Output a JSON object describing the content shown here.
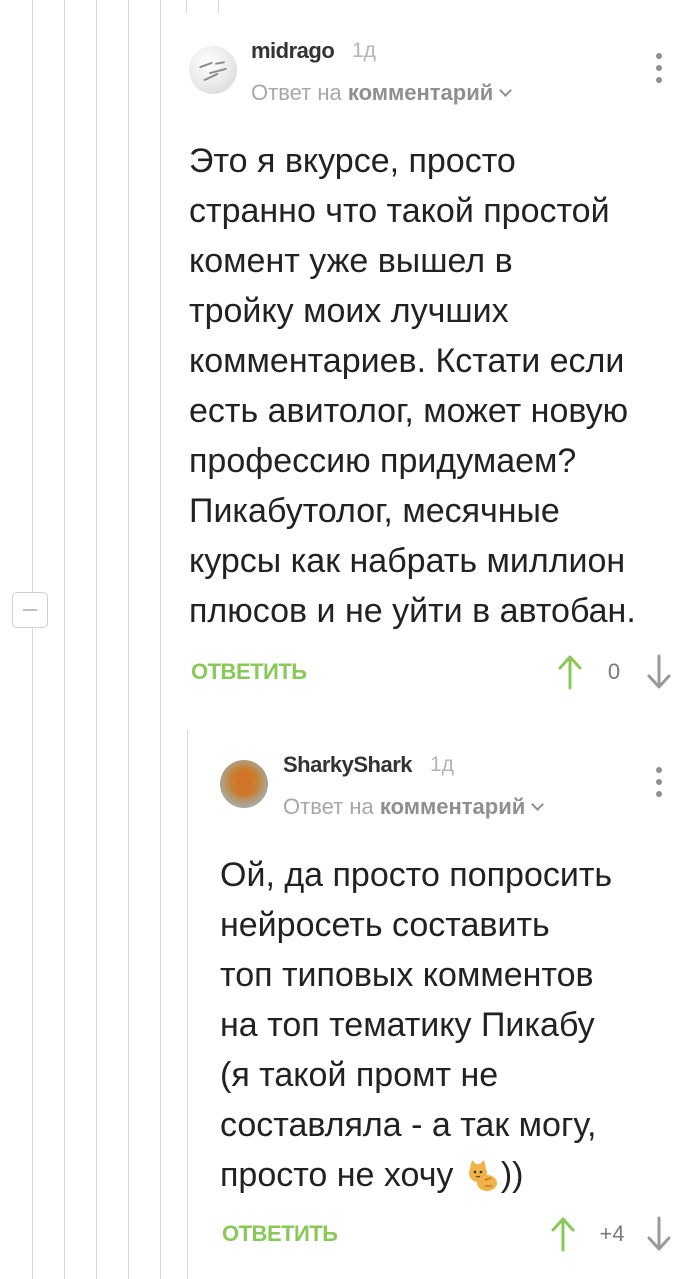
{
  "comments": [
    {
      "username": "midrago",
      "time": "1д",
      "reply_prefix": "Ответ на",
      "reply_target": "комментарий",
      "text_lines": [
        "Это я вкурсе, просто",
        "странно что такой простой",
        "комент уже вышел в",
        "тройку моих лучших",
        "комментариев. Кстати если",
        "есть авитолог, может новую",
        "профессию придумаем?",
        "Пикабутолог, месячные",
        "курсы как набрать миллион",
        "плюсов и не уйти в автобан."
      ],
      "reply_label": "ОТВЕТИТЬ",
      "rating": "0"
    },
    {
      "username": "SharkyShark",
      "time": "1д",
      "reply_prefix": "Ответ на",
      "reply_target": "комментарий",
      "text_lines": [
        "Ой, да просто попросить",
        "нейросеть составить",
        "топ типовых комментов",
        "на топ тематику Пикабу",
        "(я такой промт не",
        "составляла - а так могу,",
        "просто не хочу"
      ],
      "text_last_suffix": "))",
      "reply_label": "ОТВЕТИТЬ",
      "rating": "+4"
    }
  ],
  "icons": {
    "upvote": "arrow-up-icon",
    "downvote": "arrow-down-icon",
    "menu": "kebab-menu-icon",
    "collapse": "collapse-thread-icon",
    "emoji": "cat-emoji-icon"
  },
  "colors": {
    "accent_green": "#8ac858",
    "text": "#222222",
    "muted": "#a8a8a8",
    "thread_line": "#d9d9d9"
  }
}
